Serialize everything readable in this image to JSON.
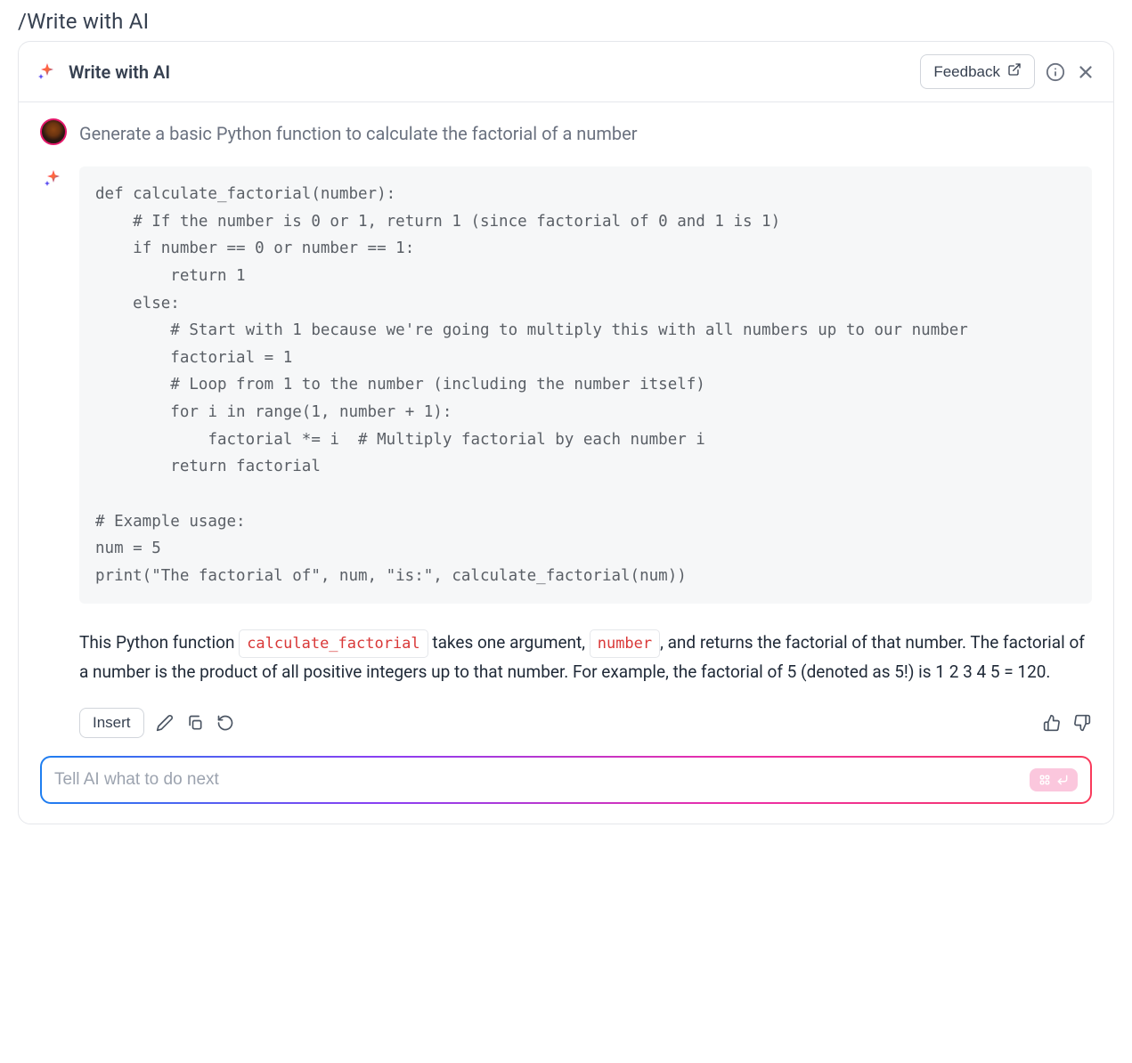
{
  "page": {
    "breadcrumb": "/Write with AI"
  },
  "header": {
    "title": "Write with AI",
    "feedback_label": "Feedback"
  },
  "user": {
    "prompt": "Generate a basic Python function to calculate the factorial of a number"
  },
  "response": {
    "code": "def calculate_factorial(number):\n    # If the number is 0 or 1, return 1 (since factorial of 0 and 1 is 1)\n    if number == 0 or number == 1:\n        return 1\n    else:\n        # Start with 1 because we're going to multiply this with all numbers up to our number\n        factorial = 1\n        # Loop from 1 to the number (including the number itself)\n        for i in range(1, number + 1):\n            factorial *= i  # Multiply factorial by each number i\n        return factorial\n\n# Example usage:\nnum = 5\nprint(\"The factorial of\", num, \"is:\", calculate_factorial(num))",
    "explain": {
      "p1a": "This Python function ",
      "code1": "calculate_factorial",
      "p1b": " takes one argument, ",
      "code2": "number",
      "p1c": ", and returns the factorial of that number. The factorial of a number is the product of all positive integers up to that number. For example, the factorial of 5 (denoted as 5!) is 1  2  3  4  5 = 120."
    }
  },
  "actions": {
    "insert_label": "Insert"
  },
  "input": {
    "placeholder": "Tell AI what to do next",
    "value": "",
    "shortcut": "⌘ ↩"
  }
}
